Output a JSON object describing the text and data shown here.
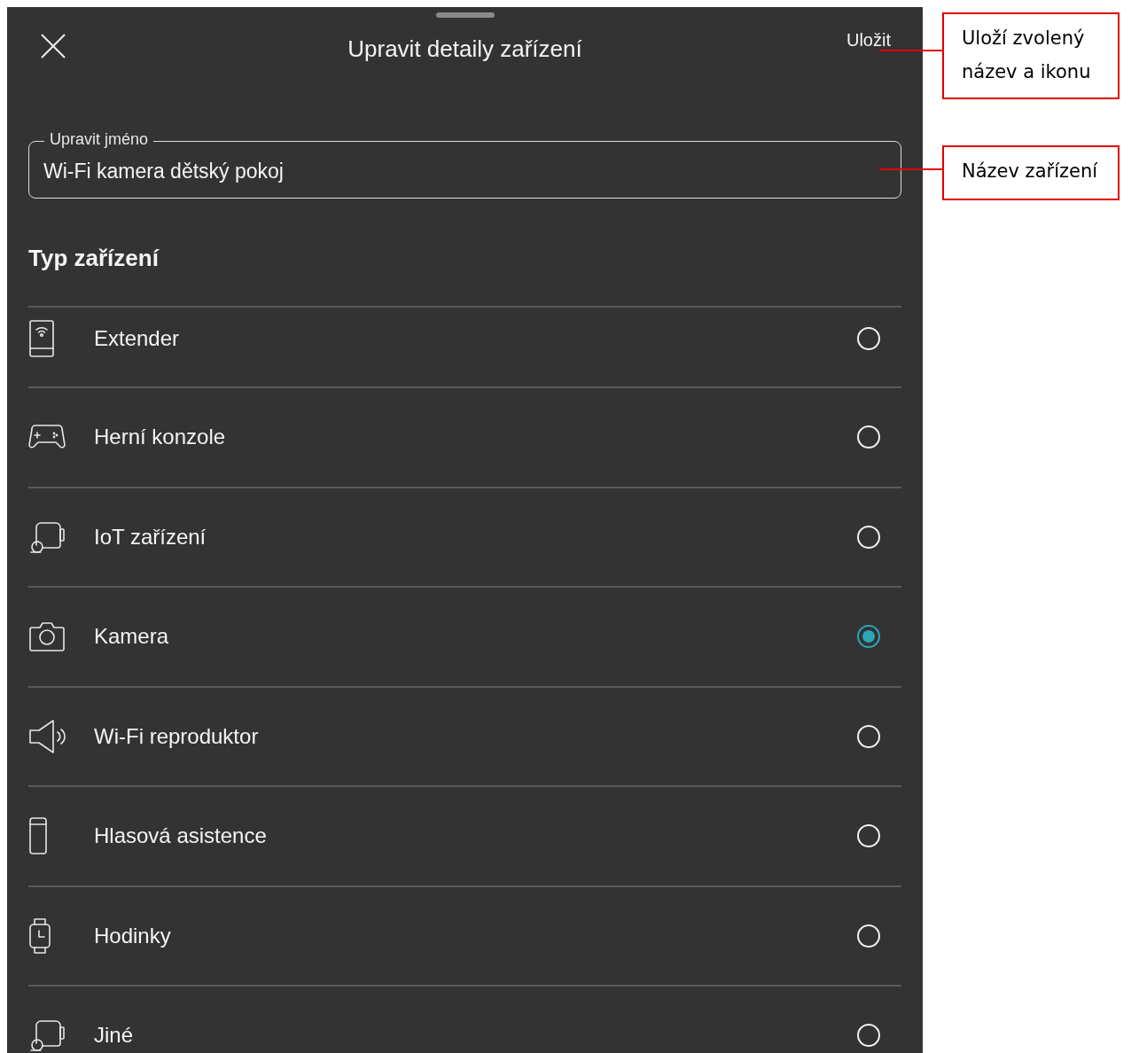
{
  "sheet": {
    "title": "Upravit detaily zařízení",
    "save": "Uložit"
  },
  "name_field": {
    "label": "Upravit jméno",
    "value": "Wi-Fi kamera dětský pokoj"
  },
  "section_title": "Typ zařízení",
  "device_types": [
    {
      "kind": "extender",
      "label": "Extender",
      "selected": false
    },
    {
      "kind": "console",
      "label": "Herní konzole",
      "selected": false
    },
    {
      "kind": "iot",
      "label": "IoT zařízení",
      "selected": false
    },
    {
      "kind": "camera",
      "label": "Kamera",
      "selected": true
    },
    {
      "kind": "speaker",
      "label": "Wi-Fi reproduktor",
      "selected": false
    },
    {
      "kind": "assistant",
      "label": "Hlasová asistence",
      "selected": false
    },
    {
      "kind": "watch",
      "label": "Hodinky",
      "selected": false
    },
    {
      "kind": "iot",
      "label": "Jiné",
      "selected": false
    }
  ],
  "annotations": [
    {
      "text": "Uloží zvolený název a ikonu"
    },
    {
      "text": "Název zařízení"
    }
  ]
}
